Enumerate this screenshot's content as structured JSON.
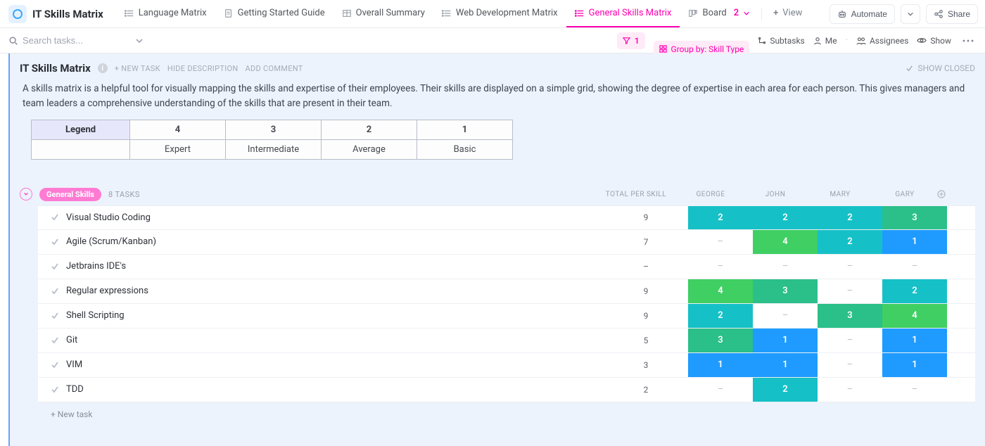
{
  "app": {
    "title": "IT Skills Matrix",
    "automate_label": "Automate",
    "share_label": "Share",
    "view_label": "View"
  },
  "tabs": [
    {
      "id": "language",
      "label": "Language Matrix"
    },
    {
      "id": "getting",
      "label": "Getting Started Guide"
    },
    {
      "id": "overall",
      "label": "Overall Summary"
    },
    {
      "id": "webdev",
      "label": "Web Development Matrix"
    },
    {
      "id": "general",
      "label": "General Skills Matrix",
      "selected": true
    },
    {
      "id": "board",
      "label": "Board",
      "count": "2"
    }
  ],
  "search": {
    "placeholder": "Search tasks..."
  },
  "toolbar": {
    "filter_count": "1",
    "group_by_label": "Group by: Skill Type",
    "subtasks_label": "Subtasks",
    "me_label": "Me",
    "assignees_label": "Assignees",
    "show_label": "Show"
  },
  "list": {
    "title": "IT Skills Matrix",
    "new_task_label": "+ NEW TASK",
    "hide_desc_label": "HIDE DESCRIPTION",
    "add_comment_label": "ADD COMMENT",
    "show_closed_label": "SHOW CLOSED",
    "description": "A skills matrix is a helpful tool for visually mapping the skills and expertise of their employees. Their skills are displayed on a simple grid, showing the degree of expertise in each area for each person. This gives managers and team leaders a comprehensive understanding of the skills that are present in their team."
  },
  "legend": {
    "header": "Legend",
    "cols": [
      "4",
      "3",
      "2",
      "1"
    ],
    "labels": [
      "Expert",
      "Intermediate",
      "Average",
      "Basic"
    ]
  },
  "group": {
    "name": "General Skills",
    "tasks_count_label": "8 TASKS",
    "columns": {
      "total": "TOTAL PER SKILL",
      "people": [
        "GEORGE",
        "JOHN",
        "MARY",
        "GARY"
      ]
    },
    "rows": [
      {
        "name": "Visual Studio Coding",
        "total": "9",
        "scores": [
          "2",
          "2",
          "2",
          "3"
        ]
      },
      {
        "name": "Agile (Scrum/Kanban)",
        "total": "7",
        "scores": [
          "–",
          "4",
          "2",
          "1"
        ]
      },
      {
        "name": "Jetbrains IDE's",
        "total": "–",
        "scores": [
          "–",
          "–",
          "–",
          "–"
        ]
      },
      {
        "name": "Regular expressions",
        "total": "9",
        "scores": [
          "4",
          "3",
          "–",
          "2"
        ]
      },
      {
        "name": "Shell Scripting",
        "total": "9",
        "scores": [
          "2",
          "–",
          "3",
          "4"
        ]
      },
      {
        "name": "Git",
        "total": "5",
        "scores": [
          "3",
          "1",
          "–",
          "1"
        ]
      },
      {
        "name": "VIM",
        "total": "3",
        "scores": [
          "1",
          "1",
          "–",
          "1"
        ]
      },
      {
        "name": "TDD",
        "total": "2",
        "scores": [
          "–",
          "2",
          "–",
          "–"
        ]
      }
    ],
    "new_task_label": "+ New task"
  }
}
